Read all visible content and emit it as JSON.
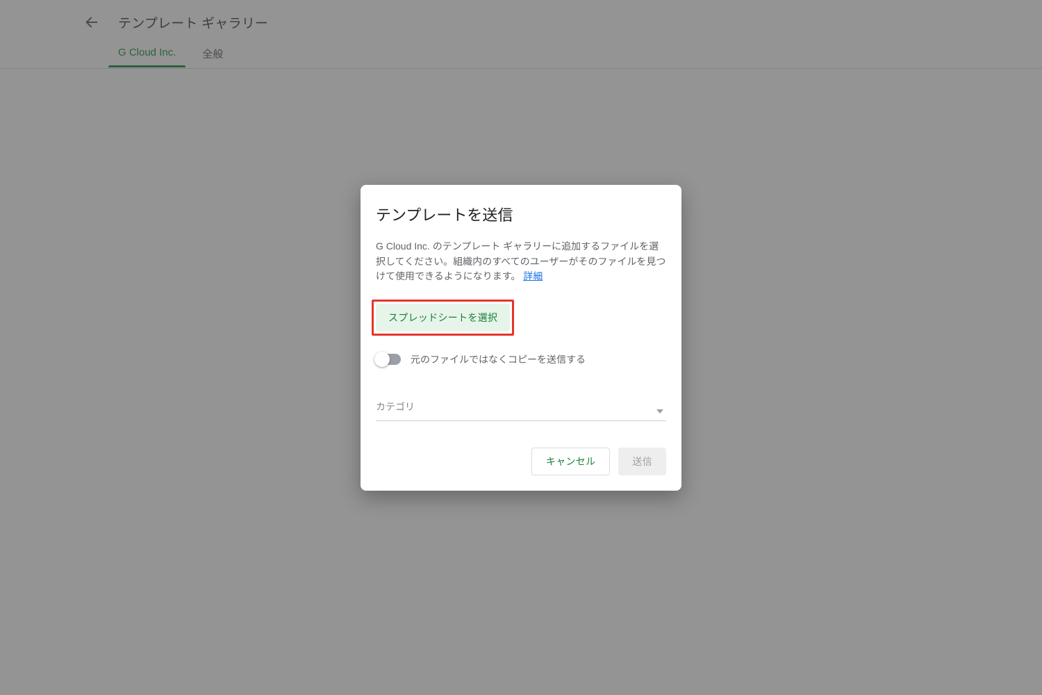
{
  "header": {
    "title": "テンプレート ギャラリー",
    "tabs": [
      {
        "label": "G Cloud Inc.",
        "active": true
      },
      {
        "label": "全般",
        "active": false
      }
    ]
  },
  "dialog": {
    "title": "テンプレートを送信",
    "description_prefix": "G Cloud Inc. のテンプレート ギャラリーに追加するファイルを選択してください。組織内のすべてのユーザーがそのファイルを見つけて使用できるようになります。",
    "details_link_label": "詳細",
    "select_button_label": "スプレッドシートを選択",
    "toggle_label": "元のファイルではなくコピーを送信する",
    "toggle_on": false,
    "category_label": "カテゴリ",
    "cancel_label": "キャンセル",
    "submit_label": "送信"
  },
  "colors": {
    "accent_green": "#188038",
    "active_tab_green": "#1e8e3e",
    "link_blue": "#1a73e8",
    "highlight_red": "#e4352b"
  }
}
